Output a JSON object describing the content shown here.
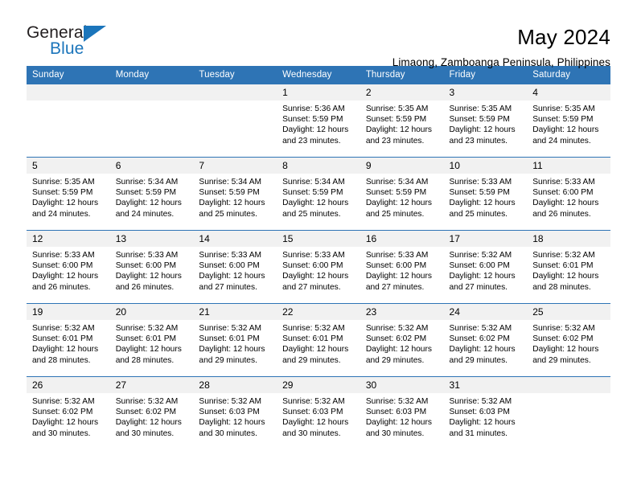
{
  "brand": {
    "name_top": "General",
    "name_bottom": "Blue",
    "accent_color": "#1b75bb"
  },
  "header": {
    "title": "May 2024",
    "subtitle": "Limaong, Zamboanga Peninsula, Philippines"
  },
  "calendar": {
    "header_color": "#2e74b5",
    "daynum_bg": "#f1f1f1",
    "weekday_headers": [
      "Sunday",
      "Monday",
      "Tuesday",
      "Wednesday",
      "Thursday",
      "Friday",
      "Saturday"
    ],
    "weeks": [
      [
        {
          "day": "",
          "blank": true
        },
        {
          "day": "",
          "blank": true
        },
        {
          "day": "",
          "blank": true
        },
        {
          "day": "1",
          "sunrise": "Sunrise: 5:36 AM",
          "sunset": "Sunset: 5:59 PM",
          "daylight_1": "Daylight: 12 hours",
          "daylight_2": "and 23 minutes."
        },
        {
          "day": "2",
          "sunrise": "Sunrise: 5:35 AM",
          "sunset": "Sunset: 5:59 PM",
          "daylight_1": "Daylight: 12 hours",
          "daylight_2": "and 23 minutes."
        },
        {
          "day": "3",
          "sunrise": "Sunrise: 5:35 AM",
          "sunset": "Sunset: 5:59 PM",
          "daylight_1": "Daylight: 12 hours",
          "daylight_2": "and 23 minutes."
        },
        {
          "day": "4",
          "sunrise": "Sunrise: 5:35 AM",
          "sunset": "Sunset: 5:59 PM",
          "daylight_1": "Daylight: 12 hours",
          "daylight_2": "and 24 minutes."
        }
      ],
      [
        {
          "day": "5",
          "sunrise": "Sunrise: 5:35 AM",
          "sunset": "Sunset: 5:59 PM",
          "daylight_1": "Daylight: 12 hours",
          "daylight_2": "and 24 minutes."
        },
        {
          "day": "6",
          "sunrise": "Sunrise: 5:34 AM",
          "sunset": "Sunset: 5:59 PM",
          "daylight_1": "Daylight: 12 hours",
          "daylight_2": "and 24 minutes."
        },
        {
          "day": "7",
          "sunrise": "Sunrise: 5:34 AM",
          "sunset": "Sunset: 5:59 PM",
          "daylight_1": "Daylight: 12 hours",
          "daylight_2": "and 25 minutes."
        },
        {
          "day": "8",
          "sunrise": "Sunrise: 5:34 AM",
          "sunset": "Sunset: 5:59 PM",
          "daylight_1": "Daylight: 12 hours",
          "daylight_2": "and 25 minutes."
        },
        {
          "day": "9",
          "sunrise": "Sunrise: 5:34 AM",
          "sunset": "Sunset: 5:59 PM",
          "daylight_1": "Daylight: 12 hours",
          "daylight_2": "and 25 minutes."
        },
        {
          "day": "10",
          "sunrise": "Sunrise: 5:33 AM",
          "sunset": "Sunset: 5:59 PM",
          "daylight_1": "Daylight: 12 hours",
          "daylight_2": "and 25 minutes."
        },
        {
          "day": "11",
          "sunrise": "Sunrise: 5:33 AM",
          "sunset": "Sunset: 6:00 PM",
          "daylight_1": "Daylight: 12 hours",
          "daylight_2": "and 26 minutes."
        }
      ],
      [
        {
          "day": "12",
          "sunrise": "Sunrise: 5:33 AM",
          "sunset": "Sunset: 6:00 PM",
          "daylight_1": "Daylight: 12 hours",
          "daylight_2": "and 26 minutes."
        },
        {
          "day": "13",
          "sunrise": "Sunrise: 5:33 AM",
          "sunset": "Sunset: 6:00 PM",
          "daylight_1": "Daylight: 12 hours",
          "daylight_2": "and 26 minutes."
        },
        {
          "day": "14",
          "sunrise": "Sunrise: 5:33 AM",
          "sunset": "Sunset: 6:00 PM",
          "daylight_1": "Daylight: 12 hours",
          "daylight_2": "and 27 minutes."
        },
        {
          "day": "15",
          "sunrise": "Sunrise: 5:33 AM",
          "sunset": "Sunset: 6:00 PM",
          "daylight_1": "Daylight: 12 hours",
          "daylight_2": "and 27 minutes."
        },
        {
          "day": "16",
          "sunrise": "Sunrise: 5:33 AM",
          "sunset": "Sunset: 6:00 PM",
          "daylight_1": "Daylight: 12 hours",
          "daylight_2": "and 27 minutes."
        },
        {
          "day": "17",
          "sunrise": "Sunrise: 5:32 AM",
          "sunset": "Sunset: 6:00 PM",
          "daylight_1": "Daylight: 12 hours",
          "daylight_2": "and 27 minutes."
        },
        {
          "day": "18",
          "sunrise": "Sunrise: 5:32 AM",
          "sunset": "Sunset: 6:01 PM",
          "daylight_1": "Daylight: 12 hours",
          "daylight_2": "and 28 minutes."
        }
      ],
      [
        {
          "day": "19",
          "sunrise": "Sunrise: 5:32 AM",
          "sunset": "Sunset: 6:01 PM",
          "daylight_1": "Daylight: 12 hours",
          "daylight_2": "and 28 minutes."
        },
        {
          "day": "20",
          "sunrise": "Sunrise: 5:32 AM",
          "sunset": "Sunset: 6:01 PM",
          "daylight_1": "Daylight: 12 hours",
          "daylight_2": "and 28 minutes."
        },
        {
          "day": "21",
          "sunrise": "Sunrise: 5:32 AM",
          "sunset": "Sunset: 6:01 PM",
          "daylight_1": "Daylight: 12 hours",
          "daylight_2": "and 29 minutes."
        },
        {
          "day": "22",
          "sunrise": "Sunrise: 5:32 AM",
          "sunset": "Sunset: 6:01 PM",
          "daylight_1": "Daylight: 12 hours",
          "daylight_2": "and 29 minutes."
        },
        {
          "day": "23",
          "sunrise": "Sunrise: 5:32 AM",
          "sunset": "Sunset: 6:02 PM",
          "daylight_1": "Daylight: 12 hours",
          "daylight_2": "and 29 minutes."
        },
        {
          "day": "24",
          "sunrise": "Sunrise: 5:32 AM",
          "sunset": "Sunset: 6:02 PM",
          "daylight_1": "Daylight: 12 hours",
          "daylight_2": "and 29 minutes."
        },
        {
          "day": "25",
          "sunrise": "Sunrise: 5:32 AM",
          "sunset": "Sunset: 6:02 PM",
          "daylight_1": "Daylight: 12 hours",
          "daylight_2": "and 29 minutes."
        }
      ],
      [
        {
          "day": "26",
          "sunrise": "Sunrise: 5:32 AM",
          "sunset": "Sunset: 6:02 PM",
          "daylight_1": "Daylight: 12 hours",
          "daylight_2": "and 30 minutes."
        },
        {
          "day": "27",
          "sunrise": "Sunrise: 5:32 AM",
          "sunset": "Sunset: 6:02 PM",
          "daylight_1": "Daylight: 12 hours",
          "daylight_2": "and 30 minutes."
        },
        {
          "day": "28",
          "sunrise": "Sunrise: 5:32 AM",
          "sunset": "Sunset: 6:03 PM",
          "daylight_1": "Daylight: 12 hours",
          "daylight_2": "and 30 minutes."
        },
        {
          "day": "29",
          "sunrise": "Sunrise: 5:32 AM",
          "sunset": "Sunset: 6:03 PM",
          "daylight_1": "Daylight: 12 hours",
          "daylight_2": "and 30 minutes."
        },
        {
          "day": "30",
          "sunrise": "Sunrise: 5:32 AM",
          "sunset": "Sunset: 6:03 PM",
          "daylight_1": "Daylight: 12 hours",
          "daylight_2": "and 30 minutes."
        },
        {
          "day": "31",
          "sunrise": "Sunrise: 5:32 AM",
          "sunset": "Sunset: 6:03 PM",
          "daylight_1": "Daylight: 12 hours",
          "daylight_2": "and 31 minutes."
        },
        {
          "day": "",
          "blank": true
        }
      ]
    ]
  }
}
